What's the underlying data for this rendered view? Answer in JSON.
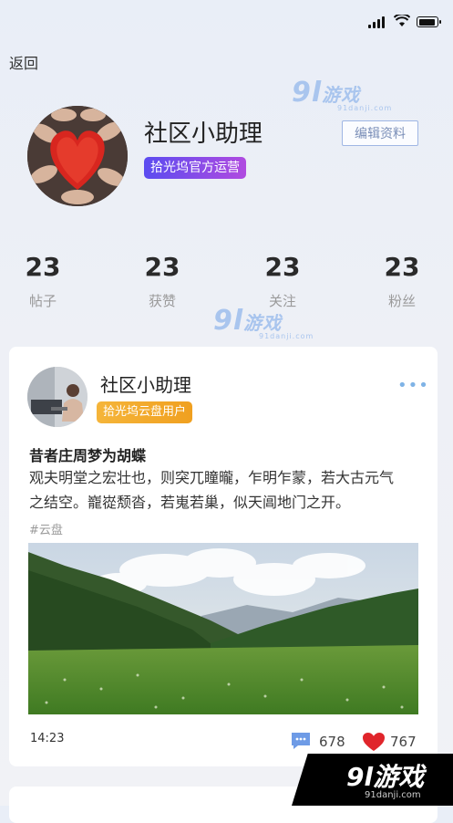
{
  "nav": {
    "back_label": "返回"
  },
  "profile": {
    "name": "社区小助理",
    "badge": "拾光坞官方运营",
    "edit_button": "编辑资料"
  },
  "stats": [
    {
      "value": "23",
      "label": "帖子"
    },
    {
      "value": "23",
      "label": "获赞"
    },
    {
      "value": "23",
      "label": "关注"
    },
    {
      "value": "23",
      "label": "粉丝"
    }
  ],
  "post": {
    "author": "社区小助理",
    "author_badge": "拾光坞云盘用户",
    "more_icon": "more-dots-icon",
    "title": "昔者庄周梦为胡蝶",
    "body_line1": "观夫明堂之宏壮也，则突兀瞳曨，乍明乍蒙，若大古元气",
    "body_line2": "之结空。巃嵸颓沓，若嵬若巢，似天阊地门之开。",
    "tag": "#云盘",
    "time": "14:23",
    "comment_count": "678",
    "like_count": "767"
  },
  "watermark": {
    "number": "9l",
    "text": "游戏",
    "url": "91danji.com"
  },
  "colors": {
    "official_badge": "#6a4cf0",
    "cloud_badge": "#f3ac2e",
    "like_heart": "#e0252b",
    "comment_icon": "#6e9be6"
  }
}
